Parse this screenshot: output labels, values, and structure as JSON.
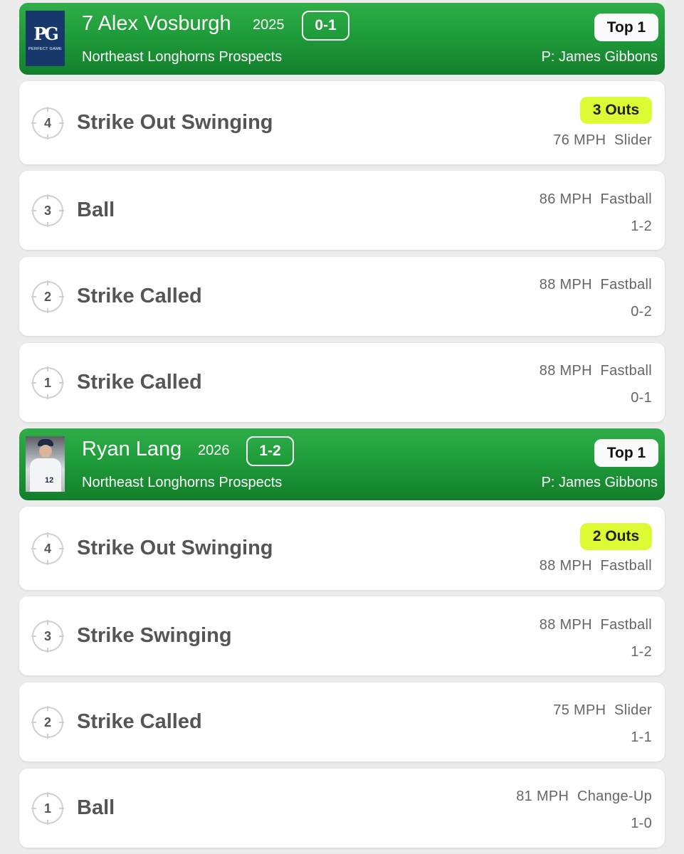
{
  "at_bats": [
    {
      "batter": {
        "name": "7 Alex Vosburgh",
        "year": "2025",
        "count": "0-1",
        "team": "Northeast Longhorns Prospects",
        "inning": "Top 1",
        "pitcher": "P: James Gibbons",
        "avatar_icon": "perfect-game-logo",
        "logo_caption": "PERFECT GAME"
      },
      "pitches": [
        {
          "number": "4",
          "result": "Strike Out Swinging",
          "outs": "3 Outs",
          "pitch": "76 MPH  Slider",
          "count": ""
        },
        {
          "number": "3",
          "result": "Ball",
          "outs": "",
          "pitch": "86 MPH  Fastball",
          "count": "1-2"
        },
        {
          "number": "2",
          "result": "Strike Called",
          "outs": "",
          "pitch": "88 MPH  Fastball",
          "count": "0-2"
        },
        {
          "number": "1",
          "result": "Strike Called",
          "outs": "",
          "pitch": "88 MPH  Fastball",
          "count": "0-1"
        }
      ]
    },
    {
      "batter": {
        "name": "Ryan Lang",
        "year": "2026",
        "count": "1-2",
        "team": "Northeast Longhorns Prospects",
        "inning": "Top 1",
        "pitcher": "P: James Gibbons",
        "avatar_icon": "player-photo"
      },
      "pitches": [
        {
          "number": "4",
          "result": "Strike Out Swinging",
          "outs": "2 Outs",
          "pitch": "88 MPH  Fastball",
          "count": ""
        },
        {
          "number": "3",
          "result": "Strike Swinging",
          "outs": "",
          "pitch": "88 MPH  Fastball",
          "count": "1-2"
        },
        {
          "number": "2",
          "result": "Strike Called",
          "outs": "",
          "pitch": "75 MPH  Slider",
          "count": "1-1"
        },
        {
          "number": "1",
          "result": "Ball",
          "outs": "",
          "pitch": "81 MPH  Change-Up",
          "count": "1-0"
        }
      ]
    }
  ],
  "colors": {
    "header_green": "#1f9c3a",
    "outs_badge": "#dcfb35",
    "background": "#ececec"
  }
}
